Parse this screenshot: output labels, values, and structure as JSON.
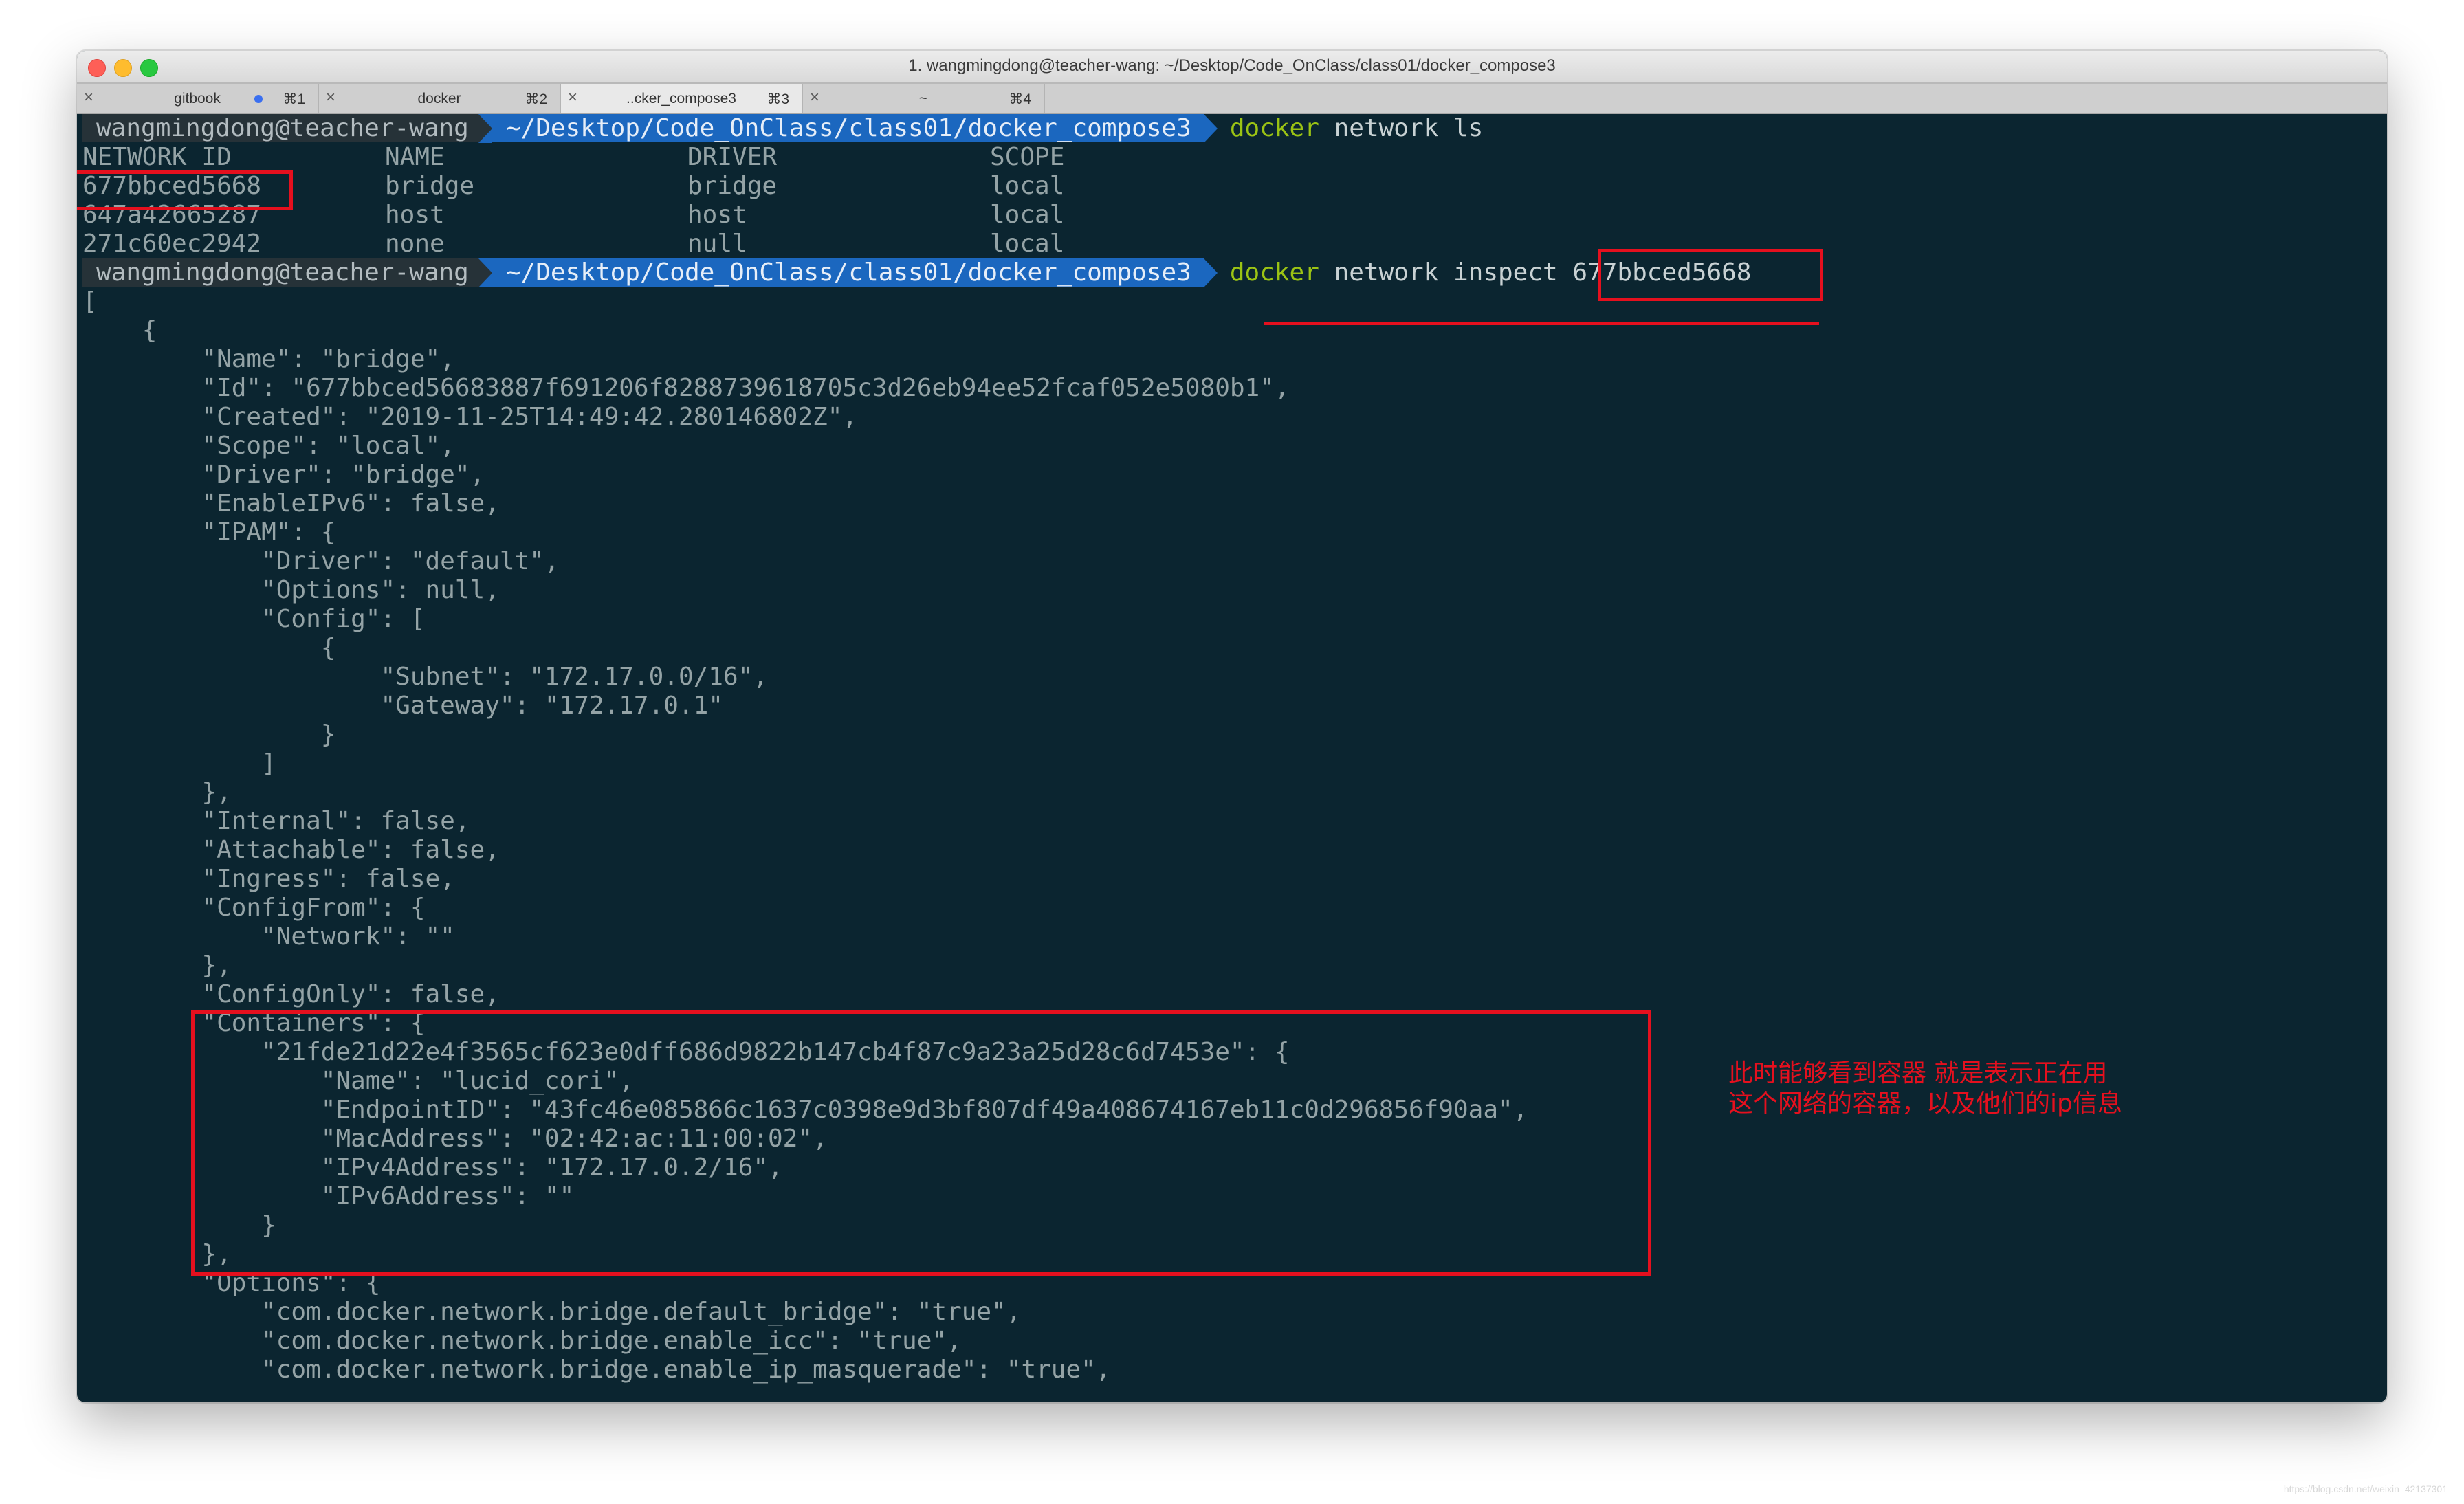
{
  "window": {
    "title": "1. wangmingdong@teacher-wang: ~/Desktop/Code_OnClass/class01/docker_compose3"
  },
  "tabs": [
    {
      "label": "gitbook",
      "shortcut": "⌘1",
      "dot": true,
      "active": false
    },
    {
      "label": "docker",
      "shortcut": "⌘2",
      "dot": false,
      "active": false
    },
    {
      "label": "..cker_compose3",
      "shortcut": "⌘3",
      "dot": false,
      "active": true
    },
    {
      "label": "~",
      "shortcut": "⌘4",
      "dot": false,
      "active": false
    }
  ],
  "prompt": {
    "user": "wangmingdong@teacher-wang",
    "path": "~/Desktop/Code_OnClass/class01/docker_compose3"
  },
  "commands": {
    "first": {
      "cmd": "docker",
      "args": "network ls"
    },
    "second": {
      "cmd": "docker",
      "args": "network inspect ",
      "highlight": "677bbced5668"
    }
  },
  "network_table": {
    "headers": [
      "NETWORK ID",
      "NAME",
      "DRIVER",
      "SCOPE"
    ],
    "rows": [
      [
        "677bbced5668",
        "bridge",
        "bridge",
        "local"
      ],
      [
        "647a42665287",
        "host",
        "host",
        "local"
      ],
      [
        "271c60ec2942",
        "none",
        "null",
        "local"
      ]
    ]
  },
  "inspect_output": [
    "[",
    "    {",
    "        \"Name\": \"bridge\",",
    "        \"Id\": \"677bbced56683887f691206f8288739618705c3d26eb94ee52fcaf052e5080b1\",",
    "        \"Created\": \"2019-11-25T14:49:42.280146802Z\",",
    "        \"Scope\": \"local\",",
    "        \"Driver\": \"bridge\",",
    "        \"EnableIPv6\": false,",
    "        \"IPAM\": {",
    "            \"Driver\": \"default\",",
    "            \"Options\": null,",
    "            \"Config\": [",
    "                {",
    "                    \"Subnet\": \"172.17.0.0/16\",",
    "                    \"Gateway\": \"172.17.0.1\"",
    "                }",
    "            ]",
    "        },",
    "        \"Internal\": false,",
    "        \"Attachable\": false,",
    "        \"Ingress\": false,",
    "        \"ConfigFrom\": {",
    "            \"Network\": \"\"",
    "        },",
    "        \"ConfigOnly\": false,",
    "        \"Containers\": {",
    "            \"21fde21d22e4f3565cf623e0dff686d9822b147cb4f87c9a23a25d28c6d7453e\": {",
    "                \"Name\": \"lucid_cori\",",
    "                \"EndpointID\": \"43fc46e085866c1637c0398e9d3bf807df49a408674167eb11c0d296856f90aa\",",
    "                \"MacAddress\": \"02:42:ac:11:00:02\",",
    "                \"IPv4Address\": \"172.17.0.2/16\",",
    "                \"IPv6Address\": \"\"",
    "            }",
    "        },",
    "        \"Options\": {",
    "            \"com.docker.network.bridge.default_bridge\": \"true\",",
    "            \"com.docker.network.bridge.enable_icc\": \"true\",",
    "            \"com.docker.network.bridge.enable_ip_masquerade\": \"true\","
  ],
  "annotation": {
    "line1": "此时能够看到容器 就是表示正在用",
    "line2": "这个网络的容器，以及他们的ip信息"
  },
  "watermark": "https://blog.csdn.net/weixin_42137301",
  "colors": {
    "terminal_bg": "#0b2530",
    "prompt_path_bg": "#1b67bf",
    "command": "#9cc414",
    "annotation_red": "#e5101e"
  }
}
